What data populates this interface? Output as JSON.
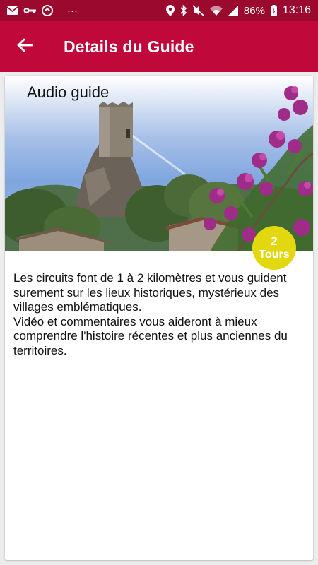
{
  "status_bar": {
    "more_indicator": "···",
    "battery_percent": "86%",
    "time": "13:16",
    "icons_left": [
      "mail-icon",
      "key-icon",
      "chat-icon"
    ],
    "icons_right": [
      "location-icon",
      "bluetooth-icon",
      "mute-icon",
      "wifi-icon",
      "signal-icon",
      "battery-icon"
    ]
  },
  "app_bar": {
    "title": "Details du Guide",
    "back_icon": "arrow-left-icon",
    "color": "#c0093a"
  },
  "guide": {
    "title": "Audio guide",
    "tours_count": "2",
    "tours_label": "Tours",
    "badge_color": "#e3d80f",
    "description_lines": [
      "Les circuits font de 1 à 2 kilomètres et vous guident surement sur les lieux historiques, mystérieux des villages emblématiques.",
      "Vidéo et commentaires vous aideront à mieux comprendre l'histoire récentes et plus anciennes du territoires."
    ]
  }
}
